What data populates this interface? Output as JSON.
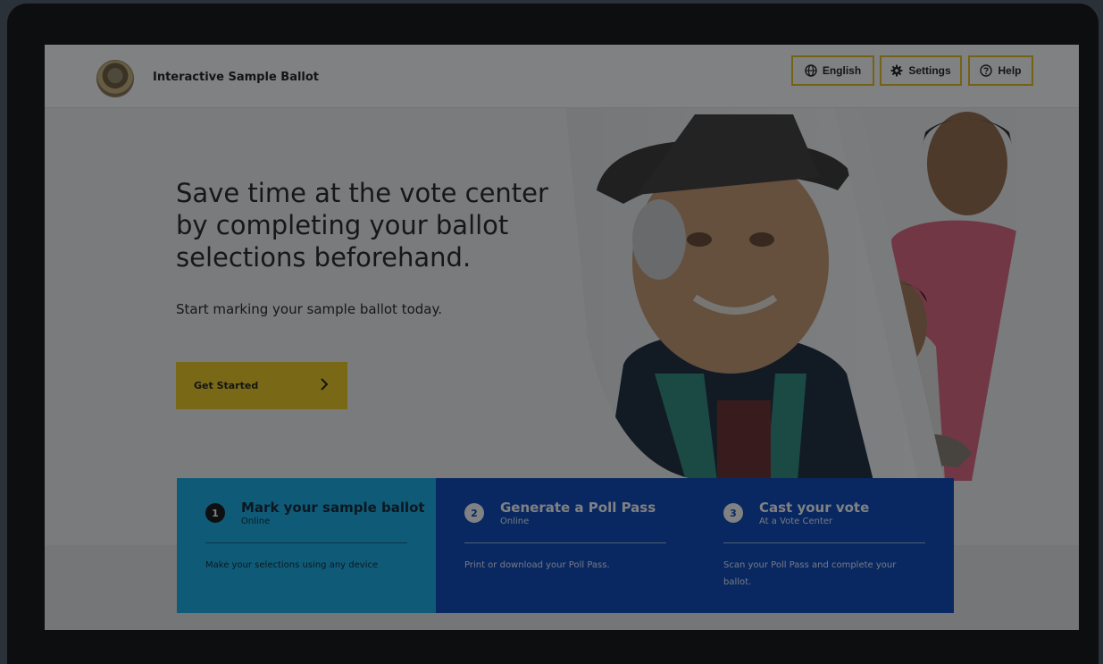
{
  "header": {
    "app_title": "Interactive Sample Ballot",
    "language_label": "English",
    "settings_label": "Settings",
    "help_label": "Help"
  },
  "hero": {
    "headline": "Save time at the vote center by completing your ballot selections beforehand.",
    "subheadline": "Start marking your sample ballot today.",
    "cta_label": "Get Started"
  },
  "steps": [
    {
      "number": "1",
      "title": "Mark your sample ballot",
      "subtitle": "Online",
      "description": "Make your selections using any device"
    },
    {
      "number": "2",
      "title": "Generate a Poll Pass",
      "subtitle": "Online",
      "description": "Print or download your Poll Pass."
    },
    {
      "number": "3",
      "title": "Cast your vote",
      "subtitle": "At a Vote Center",
      "description": "Scan your Poll Pass and complete your ballot."
    }
  ],
  "colors": {
    "accent_yellow": "#f2cc1d",
    "step_active": "#15afe7",
    "step_inactive": "#0a45b8"
  },
  "icons": {
    "language": "globe-icon",
    "settings": "gear-icon",
    "help": "help-circle-icon",
    "cta": "chevron-right-icon"
  }
}
